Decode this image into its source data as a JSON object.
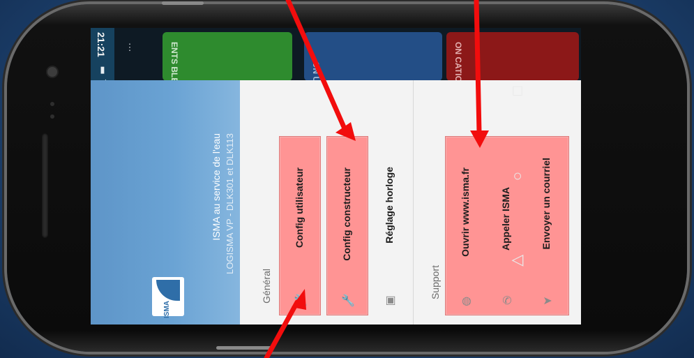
{
  "status_bar": {
    "time": "21:21",
    "icons": [
      "battery-icon",
      "signal-icon",
      "no-sim-icon",
      "wifi-icon",
      "bluetooth-icon",
      "app-notification-icon",
      "android-icon"
    ]
  },
  "background_app": {
    "menu_icon": "overflow-menu-icon",
    "tiles": [
      {
        "color": "#2e8b2e",
        "text": "ENTS\nBLES\nSV"
      },
      {
        "color": "#234e86",
        "text": "ON\nUR"
      },
      {
        "color": "#8c1818",
        "text": "ON\nCATION"
      }
    ]
  },
  "drawer": {
    "header": {
      "logo_text": "ISMA",
      "title": "ISMA au service de l'eau",
      "subtitle": "LOGISMA VP - DLK301 et DLK113"
    },
    "sections": [
      {
        "label": "Général",
        "items": [
          {
            "label": "Config utilisateur",
            "icon": "wrench-icon",
            "highlighted": true
          },
          {
            "label": "Config constructeur",
            "icon": "wrench-icon",
            "highlighted": true
          },
          {
            "label": "Réglage horloge",
            "icon": "clock-icon",
            "highlighted": false
          }
        ]
      },
      {
        "label": "Support",
        "items": [
          {
            "label": "Ouvrir www.isma.fr",
            "icon": "globe-icon",
            "highlighted": true
          },
          {
            "label": "Appeler ISMA",
            "icon": "phone-icon",
            "highlighted": true
          },
          {
            "label": "Envoyer un courriel",
            "icon": "send-icon",
            "highlighted": true
          }
        ]
      }
    ]
  },
  "nav_bar": {
    "recents": "□",
    "home": "○",
    "back": "◁"
  },
  "annotation_color": "#f20d0d"
}
